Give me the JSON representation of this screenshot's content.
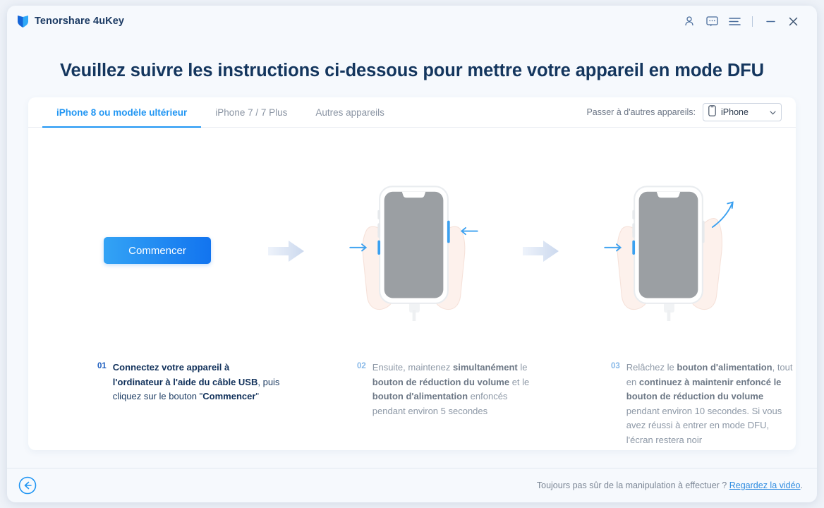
{
  "window": {
    "brand_name": "Tenorshare 4uKey",
    "logo_icon": "shield-logo-icon",
    "controls": [
      {
        "name": "account-icon",
        "label": "account"
      },
      {
        "name": "feedback-icon",
        "label": "feedback"
      },
      {
        "name": "menu-icon",
        "label": "menu"
      },
      {
        "name": "minimize-icon",
        "label": "minimize"
      },
      {
        "name": "close-icon",
        "label": "close"
      }
    ]
  },
  "page": {
    "title": "Veuillez suivre les instructions ci-dessous pour mettre votre appareil en mode DFU"
  },
  "tabs": [
    {
      "label": "iPhone 8 ou modèle ultérieur",
      "active": true
    },
    {
      "label": "iPhone 7 / 7 Plus",
      "active": false
    },
    {
      "label": "Autres appareils",
      "active": false
    }
  ],
  "device_switch": {
    "label": "Passer à d'autres appareils:",
    "selected": "iPhone",
    "icon": "phone-icon",
    "chevron": "chevron-down-icon",
    "options": [
      "iPhone"
    ]
  },
  "start_button": {
    "label": "Commencer"
  },
  "steps": [
    {
      "number": "01",
      "icon": "start-button-visual",
      "text_html": "<b>Connectez votre appareil à l'ordinateur à l'aide du câble USB</b>, puis cliquez sur le bouton \"<b>Commencer</b>\"",
      "plain": "Connectez votre appareil à l'ordinateur à l'aide du câble USB, puis cliquez sur le bouton \"Commencer\""
    },
    {
      "number": "02",
      "icon": "hands-holding-phone-press-icon",
      "text_html": "Ensuite, maintenez <b>simultanément</b> le <b>bouton de réduction du volume</b> et le <b>bouton d'alimentation</b> enfoncés pendant environ 5 secondes",
      "plain": "Ensuite, maintenez simultanément le bouton de réduction du volume et le bouton d'alimentation enfoncés pendant environ 5 secondes"
    },
    {
      "number": "03",
      "icon": "hands-holding-phone-release-icon",
      "text_html": "Relâchez le <b>bouton d'alimentation</b>, tout en <b>continuez à maintenir enfoncé le bouton de réduction du volume</b> pendant environ 10 secondes. Si vous avez réussi à entrer en mode DFU, l'écran restera noir",
      "plain": "Relâchez le bouton d'alimentation, tout en continuez à maintenir enfoncé le bouton de réduction du volume pendant environ 10 secondes. Si vous avez réussi à entrer en mode DFU, l'écran restera noir"
    }
  ],
  "footer": {
    "back_icon": "back-arrow-circle-icon",
    "question": "Toujours pas sûr de la manipulation à effectuer ?",
    "link": "Regardez la vidéo",
    "trailing": "."
  },
  "colors": {
    "accent": "#2196f3",
    "title": "#14365e",
    "muted": "#8d98a6",
    "card_bg": "#ffffff",
    "window_bg": "#f6f9fd",
    "button_gradient_from": "#33a3f5",
    "button_gradient_to": "#1274ef"
  }
}
